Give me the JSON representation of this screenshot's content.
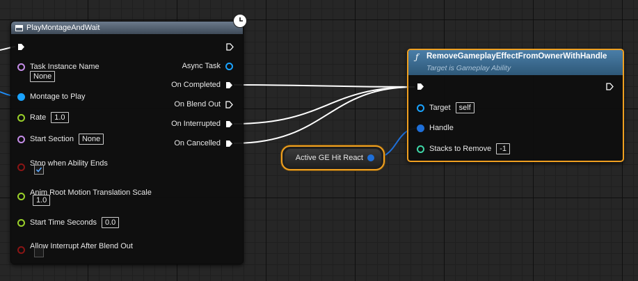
{
  "play_montage_node": {
    "title": "PlayMontageAndWait",
    "inputs": {
      "task_instance_name_label": "Task Instance Name",
      "task_instance_name_value": "None",
      "montage_to_play_label": "Montage to Play",
      "rate_label": "Rate",
      "rate_value": "1.0",
      "start_section_label": "Start Section",
      "start_section_value": "None",
      "stop_when_ability_ends_label": "Stop when Ability Ends",
      "stop_when_ability_ends_checked": true,
      "anim_root_motion_label": "Anim Root Motion Translation Scale",
      "anim_root_motion_value": "1.0",
      "start_time_seconds_label": "Start Time Seconds",
      "start_time_seconds_value": "0.0",
      "allow_interrupt_label": "Allow Interrupt After Blend Out",
      "allow_interrupt_checked": false
    },
    "outputs": {
      "async_task": "Async Task",
      "on_completed": "On Completed",
      "on_blend_out": "On Blend Out",
      "on_interrupted": "On Interrupted",
      "on_cancelled": "On Cancelled"
    }
  },
  "variable_node": {
    "label": "Active GE Hit React"
  },
  "remove_effect_node": {
    "title": "RemoveGameplayEffectFromOwnerWithHandle",
    "subtitle": "Target is Gameplay Ability",
    "function_glyph": "ƒ",
    "target_label": "Target",
    "target_value": "self",
    "handle_label": "Handle",
    "stacks_label": "Stacks to Remove",
    "stacks_value": "-1"
  },
  "icons": {
    "latent_clock": "clock-icon",
    "node_icon": "node-icon"
  },
  "colors": {
    "exec": "#ffffff",
    "object_pin": "#7b50c8",
    "struct_pin": "#1e90ff",
    "float_pin": "#9ad12a",
    "bool_pin": "#a01818",
    "name_pin": "#c58de8",
    "int_pin": "#3fd8a8",
    "selection": "#f0a020",
    "function_header": "#3d6f97",
    "async_header": "#5d6f84"
  }
}
